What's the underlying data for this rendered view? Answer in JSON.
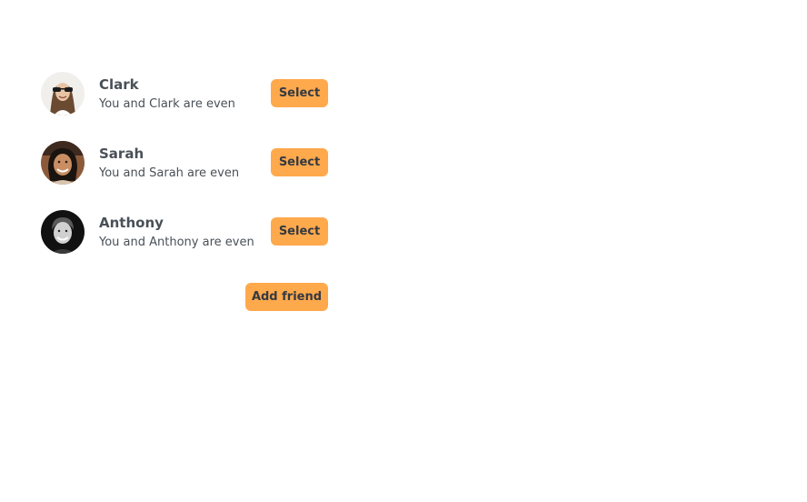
{
  "friends": [
    {
      "name": "Clark",
      "balance_text": "You and Clark are even",
      "select_label": "Select",
      "avatar": "clark-photo"
    },
    {
      "name": "Sarah",
      "balance_text": "You and Sarah are even",
      "select_label": "Select",
      "avatar": "sarah-photo"
    },
    {
      "name": "Anthony",
      "balance_text": "You and Anthony are even",
      "select_label": "Select",
      "avatar": "anthony-photo"
    }
  ],
  "add_friend_label": "Add friend",
  "colors": {
    "button_bg": "#ffa94d",
    "button_text": "#343a40",
    "text": "#495057",
    "background": "#ffffff"
  }
}
